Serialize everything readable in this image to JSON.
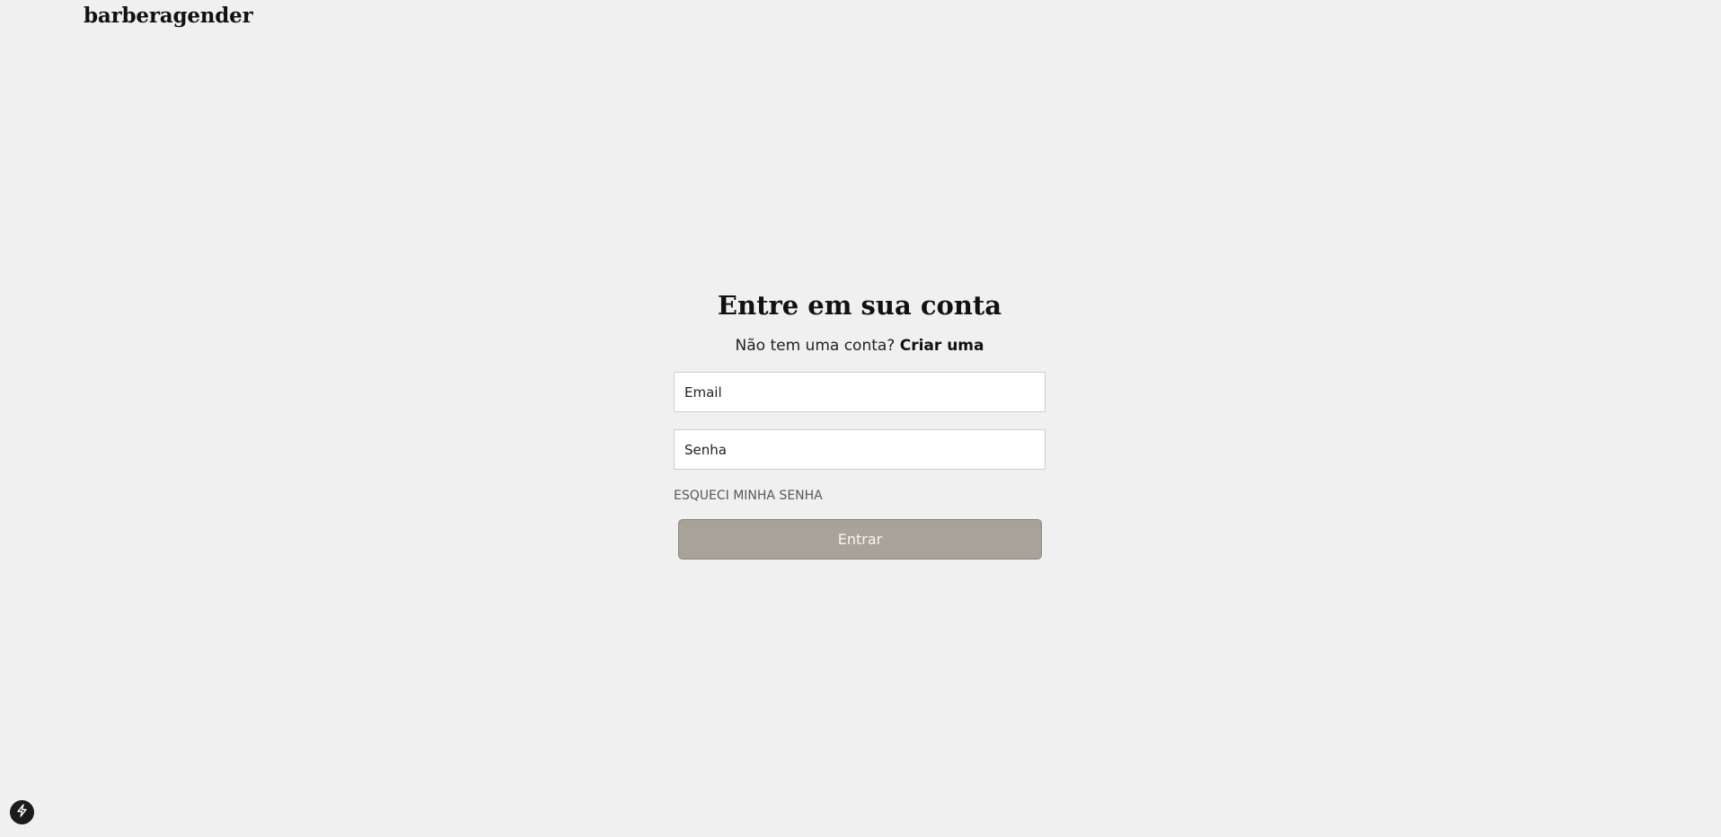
{
  "header": {
    "logo_text": "barberagender"
  },
  "login": {
    "title": "Entre em sua conta",
    "signup_prompt": "Não tem uma conta?",
    "signup_link": "Criar uma",
    "email_placeholder": "Email",
    "password_placeholder": "Senha",
    "forgot_password": "ESQUECI MINHA SENHA",
    "submit_label": "Entrar"
  },
  "dev_indicator": {
    "icon": "lightning-bolt-icon"
  },
  "colors": {
    "background": "#f0f0f0",
    "button_background": "#a9a298",
    "button_text": "#f7f5f2",
    "forgot_link": "#555a52",
    "input_border": "#cfcfcf"
  }
}
